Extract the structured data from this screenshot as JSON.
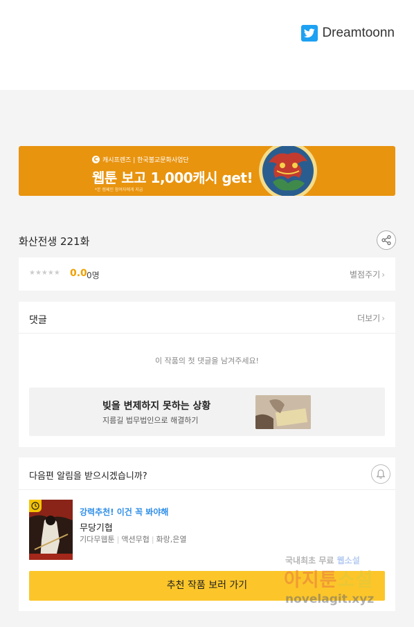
{
  "header": {
    "twitter_name": "Dreamtoonn"
  },
  "banner": {
    "brand_line": "캐시프렌즈 | 한국불교문화사업단",
    "headline": "웹툰 보고 1,000캐시 get!",
    "fine_print": "*본 캠페인 참여자에게 지급"
  },
  "episode": {
    "title": "화산전생 221화"
  },
  "rating": {
    "stars": "★★★★★",
    "score": "0.0",
    "count": "0명",
    "rate_link": "별점주기"
  },
  "comments": {
    "header": "댓글",
    "more_link": "더보기",
    "empty_text": "이 작품의 첫 댓글을 남겨주세요!",
    "ad": {
      "title": "빚을 변제하지 못하는 상황",
      "subtitle": "지름길 법무법인으로 해결하기"
    }
  },
  "notify": {
    "question": "다음편 알림을 받으시겠습니까?",
    "recommend_label": "강력추천! 이건 꼭 봐야해",
    "recommend_title": "무당기협",
    "tags": [
      "기다무웹툰",
      "액션무협",
      "화랑,은열"
    ],
    "cta_label": "추천 작품 보러 가기"
  },
  "watermark": {
    "line1_a": "국내최초 무료 ",
    "line1_b": "웹소설",
    "line2_a": "아지툰",
    "line2_b": "소설",
    "line3": "novelagit.xyz"
  },
  "colors": {
    "banner_bg": "#e8940f",
    "cta_bg": "#fcc62a",
    "score": "#f0a000",
    "recommend_label": "#2e8ee8",
    "twitter": "#1da1f2"
  }
}
